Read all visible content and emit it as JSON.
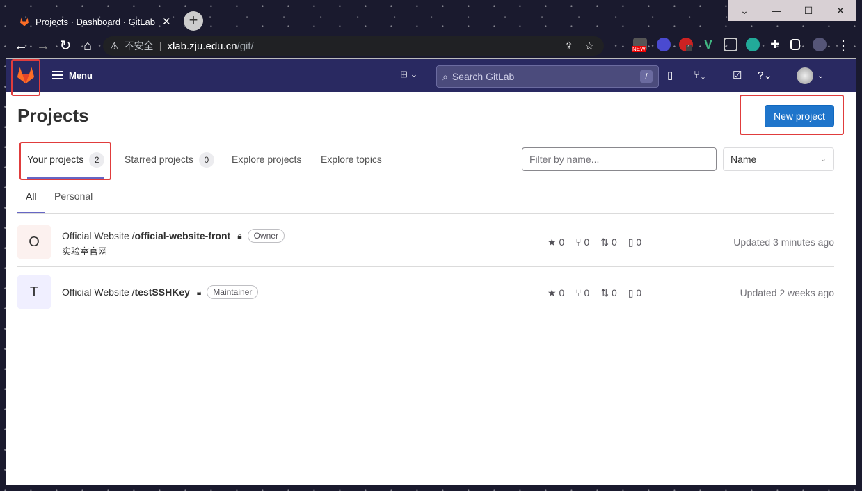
{
  "browser": {
    "tab_title": "Projects · Dashboard · GitLab",
    "tab_close": "✕",
    "new_tab": "+",
    "window_buttons": [
      "⌄",
      "—",
      "☐",
      "✕"
    ],
    "url_warning": "不安全",
    "url_host": "xlab.zju.edu.cn",
    "url_path": "/git/",
    "ext_new_badge": "NEW",
    "ext_count_badge": "1"
  },
  "topbar": {
    "menu_label": "Menu",
    "search_placeholder": "Search GitLab",
    "search_shortcut": "/"
  },
  "page": {
    "title": "Projects",
    "new_project_label": "New project"
  },
  "tabs": [
    {
      "label": "Your projects",
      "count": "2"
    },
    {
      "label": "Starred projects",
      "count": "0"
    },
    {
      "label": "Explore projects"
    },
    {
      "label": "Explore topics"
    }
  ],
  "filter": {
    "placeholder": "Filter by name..."
  },
  "sort": {
    "selected": "Name"
  },
  "subtabs": [
    "All",
    "Personal"
  ],
  "projects": [
    {
      "avatar_letter": "O",
      "namespace": "Official Website / ",
      "name": "official-website-front",
      "role": "Owner",
      "description": "实验室官网",
      "stars": "0",
      "forks": "0",
      "merge_requests": "0",
      "issues": "0",
      "updated": "Updated 3 minutes ago"
    },
    {
      "avatar_letter": "T",
      "namespace": "Official Website / ",
      "name": "testSSHKey",
      "role": "Maintainer",
      "description": "",
      "stars": "0",
      "forks": "0",
      "merge_requests": "0",
      "issues": "0",
      "updated": "Updated 2 weeks ago"
    }
  ],
  "colors": {
    "topbar": "#292961",
    "accent": "#1f75cb",
    "highlight": "#e03c3c",
    "tab_underline": "#6666c4"
  }
}
